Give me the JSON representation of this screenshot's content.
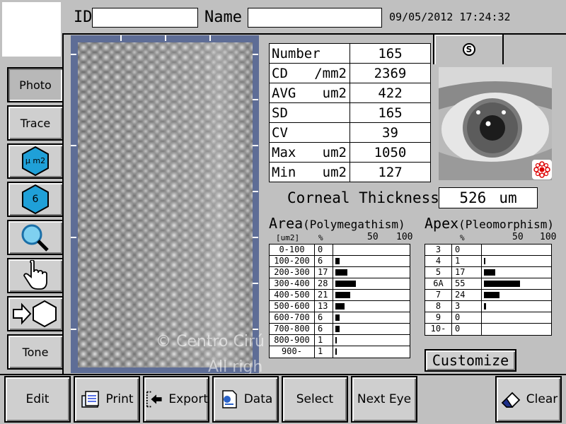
{
  "header": {
    "id_label": "ID",
    "id_value": "",
    "name_label": "Name",
    "name_value": "",
    "datetime": "09/05/2012 17:24:32"
  },
  "tab": {
    "icon": "s-circle-icon",
    "label": "S"
  },
  "toolbar": {
    "photo": "Photo",
    "trace": "Trace",
    "um2": "μ m2",
    "six": "6",
    "tone": "Tone"
  },
  "stats": [
    {
      "label": "Number",
      "unit": "",
      "value": "165"
    },
    {
      "label": "CD",
      "unit": "/mm2",
      "value": "2369"
    },
    {
      "label": "AVG",
      "unit": "um2",
      "value": "422"
    },
    {
      "label": "SD",
      "unit": "",
      "value": "165"
    },
    {
      "label": "CV",
      "unit": "",
      "value": "39"
    },
    {
      "label": "Max",
      "unit": "um2",
      "value": "1050"
    },
    {
      "label": "Min",
      "unit": "um2",
      "value": "127"
    }
  ],
  "corneal": {
    "label": "Corneal Thickness",
    "value": "526",
    "unit": "um"
  },
  "area": {
    "title": "Area",
    "subtitle": "(Polymegathism)",
    "unit_header": "[um2]",
    "pct_header": "%",
    "scale_50": "50",
    "scale_100": "100",
    "rows": [
      {
        "range": "0-100",
        "value": "0",
        "pct": 0
      },
      {
        "range": "100-200",
        "value": "6",
        "pct": 6
      },
      {
        "range": "200-300",
        "value": "17",
        "pct": 17
      },
      {
        "range": "300-400",
        "value": "28",
        "pct": 28
      },
      {
        "range": "400-500",
        "value": "21",
        "pct": 21
      },
      {
        "range": "500-600",
        "value": "13",
        "pct": 13
      },
      {
        "range": "600-700",
        "value": "6",
        "pct": 6
      },
      {
        "range": "700-800",
        "value": "6",
        "pct": 6
      },
      {
        "range": "800-900",
        "value": "1",
        "pct": 1
      },
      {
        "range": "900-",
        "value": "1",
        "pct": 1
      }
    ]
  },
  "apex": {
    "title": "Apex",
    "subtitle": "(Pleomorphism)",
    "pct_header": "%",
    "scale_50": "50",
    "scale_100": "100",
    "rows": [
      {
        "apex": "3",
        "value": "0",
        "pct": 0
      },
      {
        "apex": "4",
        "value": "1",
        "pct": 1
      },
      {
        "apex": "5",
        "value": "17",
        "pct": 17
      },
      {
        "apex": "6A",
        "value": "55",
        "pct": 55
      },
      {
        "apex": "7",
        "value": "24",
        "pct": 24
      },
      {
        "apex": "8",
        "value": "3",
        "pct": 3
      },
      {
        "apex": "9",
        "value": "0",
        "pct": 0
      },
      {
        "apex": "10-",
        "value": "0",
        "pct": 0
      }
    ]
  },
  "customize": "Customize",
  "watermark": {
    "line1": "© Centro Cirú",
    "line2": "All righ"
  },
  "bottom": {
    "edit": "Edit",
    "print": "Print",
    "export": "Export",
    "data": "Data",
    "select": "Select",
    "next_eye": "Next Eye",
    "clear": "Clear"
  }
}
